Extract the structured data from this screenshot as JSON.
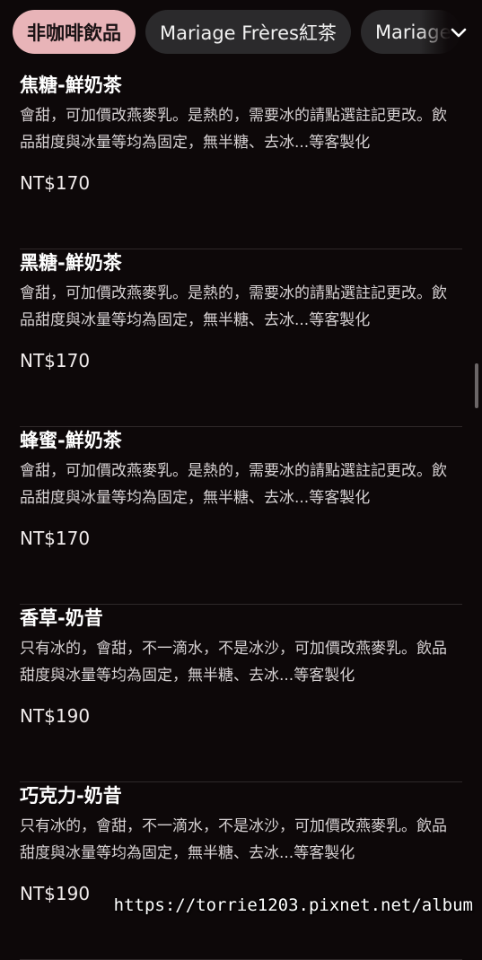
{
  "tabs": [
    {
      "label": "非咖啡飲品",
      "active": true
    },
    {
      "label": "Mariage Frères紅茶",
      "active": false
    },
    {
      "label": "Mariage",
      "active": false
    }
  ],
  "tabs_menu_icon": "chevron-down-icon",
  "items": [
    {
      "title": "焦糖-鮮奶茶",
      "description": "會甜，可加價改燕麥乳。是熱的，需要冰的請點選註記更改。飲品甜度與冰量等均為固定，無半糖、去冰...等客製化",
      "price": "NT$170"
    },
    {
      "title": "黑糖-鮮奶茶",
      "description": "會甜，可加價改燕麥乳。是熱的，需要冰的請點選註記更改。飲品甜度與冰量等均為固定，無半糖、去冰...等客製化",
      "price": "NT$170"
    },
    {
      "title": "蜂蜜-鮮奶茶",
      "description": "會甜，可加價改燕麥乳。是熱的，需要冰的請點選註記更改。飲品甜度與冰量等均為固定，無半糖、去冰...等客製化",
      "price": "NT$170"
    },
    {
      "title": "香草-奶昔",
      "description": "只有冰的，會甜，不一滴水，不是冰沙，可加價改燕麥乳。飲品甜度與冰量等均為固定，無半糖、去冰...等客製化",
      "price": "NT$190"
    },
    {
      "title": "巧克力-奶昔",
      "description": "只有冰的，會甜，不一滴水，不是冰沙，可加價改燕麥乳。飲品甜度與冰量等均為固定，無半糖、去冰...等客製化",
      "price": "NT$190"
    }
  ],
  "watermark": "https://torrie1203.pixnet.net/album",
  "colors": {
    "background": "#0d0809",
    "active_tab": "#e8b4b8",
    "tab": "#2b2a2c",
    "divider": "#2e2829"
  }
}
